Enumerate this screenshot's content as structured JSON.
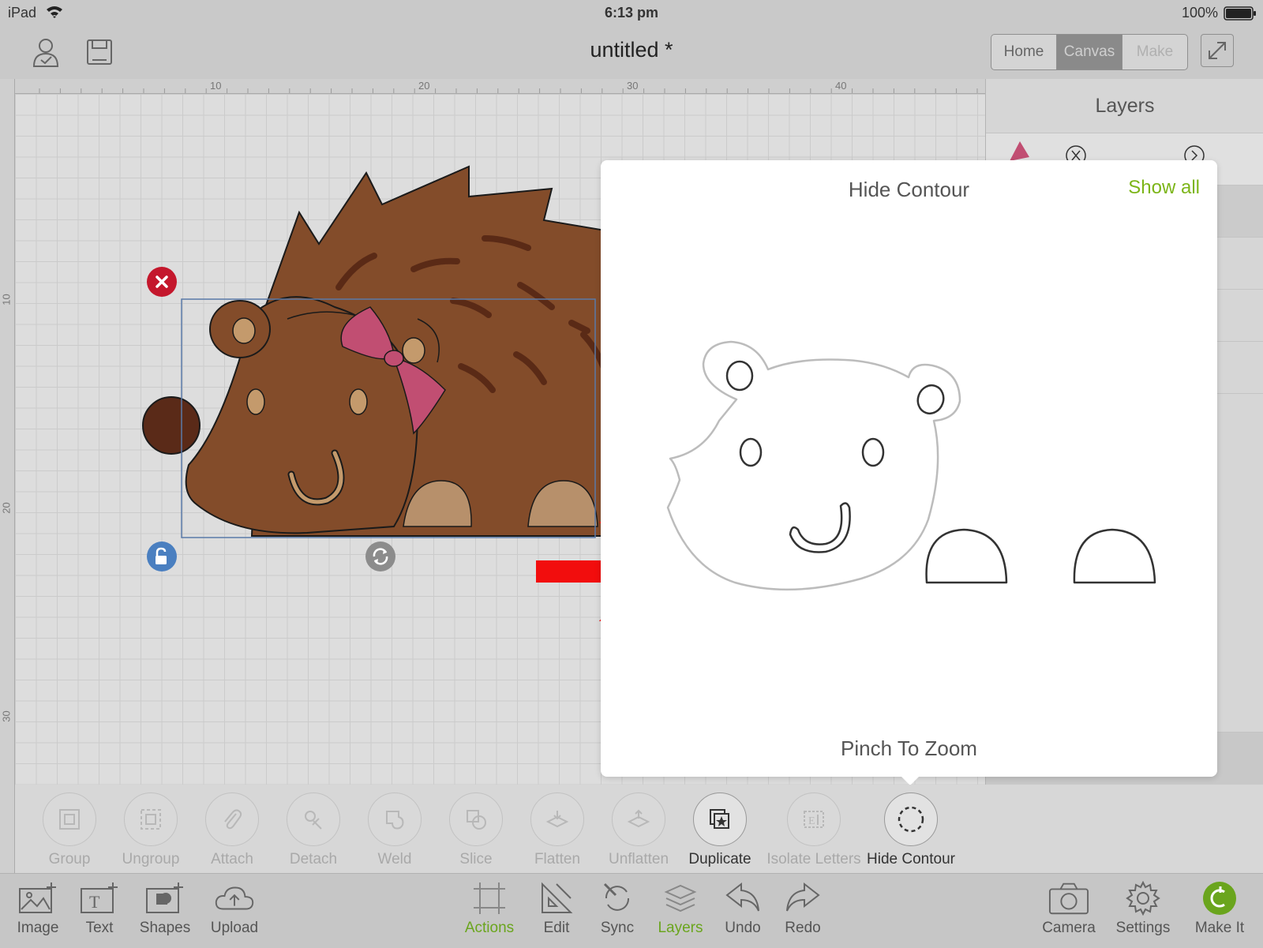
{
  "status_bar": {
    "device": "iPad",
    "time": "6:13 pm",
    "battery": "100%"
  },
  "top_bar": {
    "title": "untitled *",
    "tabs": [
      {
        "label": "Home",
        "state": "normal"
      },
      {
        "label": "Canvas",
        "state": "active"
      },
      {
        "label": "Make",
        "state": "disabled"
      }
    ]
  },
  "rulers": {
    "horizontal": [
      "10",
      "20",
      "30",
      "40"
    ],
    "vertical": [
      "10",
      "20",
      "30"
    ]
  },
  "layers_panel": {
    "title": "Layers"
  },
  "popover": {
    "title": "Hide Contour",
    "show_all": "Show all",
    "hint": "Pinch To Zoom"
  },
  "actions": [
    {
      "label": "Group",
      "icon": "group-icon",
      "enabled": false
    },
    {
      "label": "Ungroup",
      "icon": "ungroup-icon",
      "enabled": false
    },
    {
      "label": "Attach",
      "icon": "paperclip-icon",
      "enabled": false
    },
    {
      "label": "Detach",
      "icon": "detach-icon",
      "enabled": false
    },
    {
      "label": "Weld",
      "icon": "weld-icon",
      "enabled": false
    },
    {
      "label": "Slice",
      "icon": "slice-icon",
      "enabled": false
    },
    {
      "label": "Flatten",
      "icon": "flatten-icon",
      "enabled": false
    },
    {
      "label": "Unflatten",
      "icon": "unflatten-icon",
      "enabled": false
    },
    {
      "label": "Duplicate",
      "icon": "duplicate-icon",
      "enabled": true
    },
    {
      "label": "Isolate Letters",
      "icon": "isolate-letters-icon",
      "enabled": false
    },
    {
      "label": "Hide Contour",
      "icon": "hide-contour-icon",
      "enabled": true
    }
  ],
  "bottom_bar": {
    "left": [
      {
        "label": "Image",
        "icon": "image-add-icon"
      },
      {
        "label": "Text",
        "icon": "text-add-icon"
      },
      {
        "label": "Shapes",
        "icon": "shapes-add-icon"
      },
      {
        "label": "Upload",
        "icon": "upload-cloud-icon"
      }
    ],
    "center": [
      {
        "label": "Actions",
        "icon": "actions-icon",
        "active": true
      },
      {
        "label": "Edit",
        "icon": "edit-ruler-icon",
        "active": false
      },
      {
        "label": "Sync",
        "icon": "sync-icon",
        "active": false
      },
      {
        "label": "Layers",
        "icon": "layers-icon",
        "active": true
      },
      {
        "label": "Undo",
        "icon": "undo-icon",
        "active": false
      },
      {
        "label": "Redo",
        "icon": "redo-icon",
        "active": false
      }
    ],
    "right": [
      {
        "label": "Camera",
        "icon": "camera-icon"
      },
      {
        "label": "Settings",
        "icon": "gear-icon"
      },
      {
        "label": "Make It",
        "icon": "make-it-icon"
      }
    ]
  },
  "colors": {
    "accent_green": "#7cb518",
    "hedgehog_body": "#834c2a",
    "hedgehog_feet": "#b7906b",
    "bow_pink": "#c14e72",
    "delete_red": "#c4172c",
    "lock_blue": "#4a7fc0",
    "arrow_red": "#f20d0d"
  }
}
